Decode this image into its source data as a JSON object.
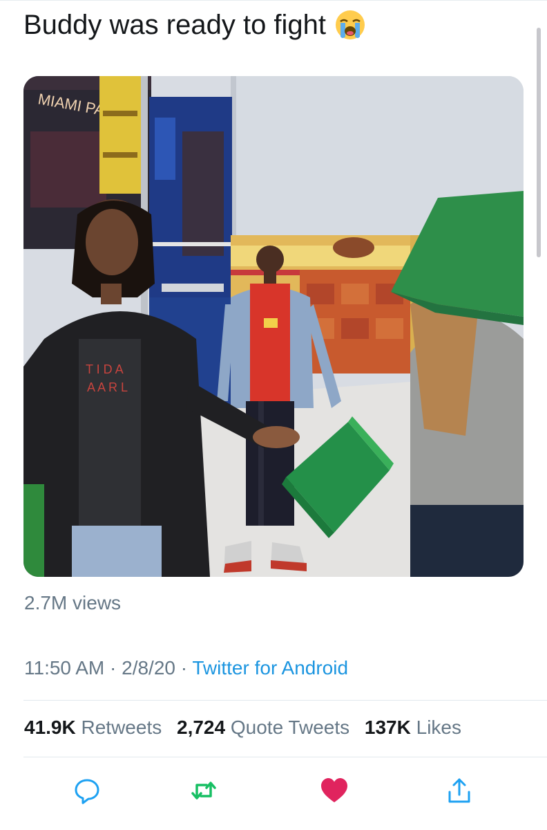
{
  "tweet": {
    "text": "Buddy was ready to fight",
    "emoji_icon": "loudly-crying-face-icon"
  },
  "media": {
    "type": "video",
    "views": "2.7M views",
    "store_sign": "MIAMI PARTY"
  },
  "meta": {
    "time": "11:50 AM",
    "separator": "·",
    "date": "2/8/20",
    "source": "Twitter for Android"
  },
  "stats": {
    "retweets_count": "41.9K",
    "retweets_label": "Retweets",
    "quotes_count": "2,724",
    "quotes_label": "Quote Tweets",
    "likes_count": "137K",
    "likes_label": "Likes"
  },
  "actions": [
    {
      "icon": "reply-icon",
      "color": "#1da1f2"
    },
    {
      "icon": "retweet-icon",
      "color": "#17bf63"
    },
    {
      "icon": "heart-icon",
      "color": "#e0245e"
    },
    {
      "icon": "share-icon",
      "color": "#1da1f2"
    }
  ],
  "colors": {
    "text": "#14171a",
    "secondary": "#657786",
    "link": "#1b95e0",
    "retweet_green": "#17bf63",
    "like_red": "#e0245e"
  }
}
